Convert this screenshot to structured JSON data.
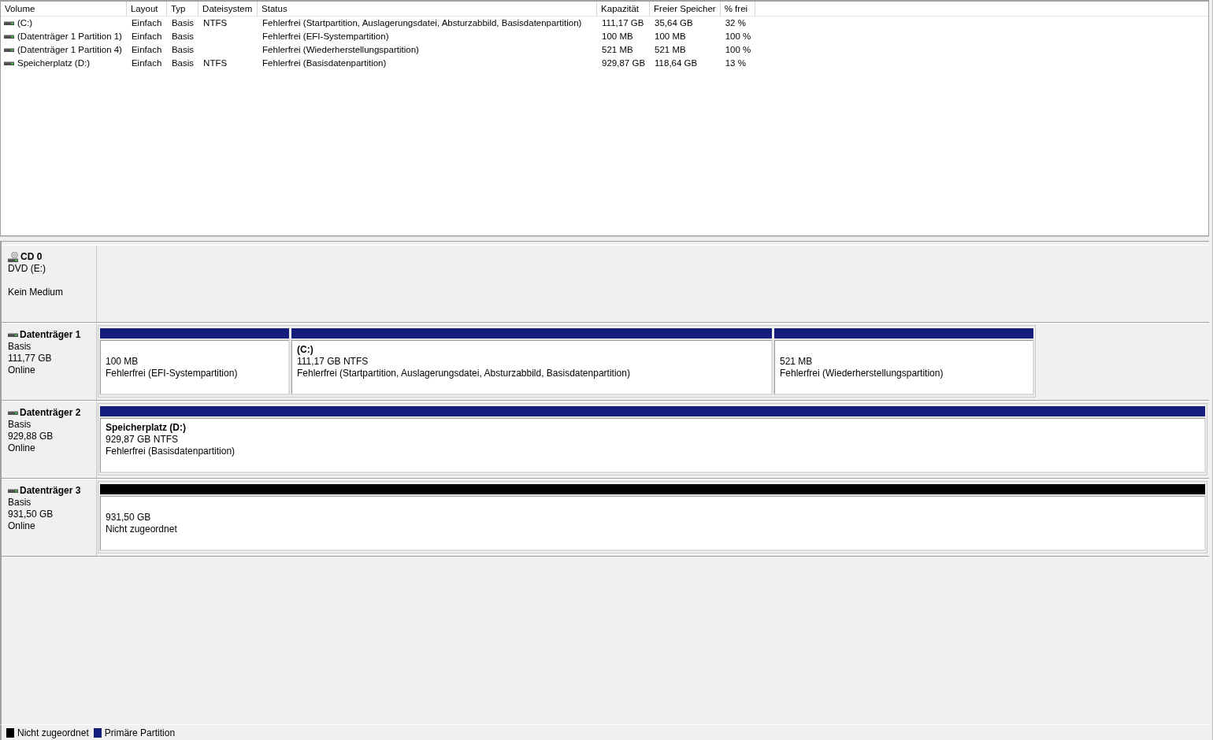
{
  "volume_list": {
    "columns": [
      "Volume",
      "Layout",
      "Typ",
      "Dateisystem",
      "Status",
      "Kapazität",
      "Freier Speicher",
      "% frei"
    ],
    "rows": [
      {
        "volume": "(C:)",
        "layout": "Einfach",
        "type": "Basis",
        "file_system": "NTFS",
        "status": "Fehlerfrei (Startpartition, Auslagerungsdatei, Absturzabbild, Basisdatenpartition)",
        "capacity": "111,17 GB",
        "free_space": "35,64 GB",
        "percent_free": "32 %"
      },
      {
        "volume": "(Datenträger 1 Partition 1)",
        "layout": "Einfach",
        "type": "Basis",
        "status": "Fehlerfrei (EFI-Systempartition)",
        "capacity": "100 MB",
        "free_space": "100 MB",
        "percent_free": "100 %"
      },
      {
        "volume": "(Datenträger 1 Partition 4)",
        "layout": "Einfach",
        "type": "Basis",
        "status": "Fehlerfrei (Wiederherstellungspartition)",
        "capacity": "521 MB",
        "free_space": "521 MB",
        "percent_free": "100 %"
      },
      {
        "volume": "Speicherplatz (D:)",
        "layout": "Einfach",
        "type": "Basis",
        "file_system": "NTFS",
        "status": "Fehlerfrei (Basisdatenpartition)",
        "capacity": "929,87 GB",
        "free_space": "118,64 GB",
        "percent_free": "13 %"
      }
    ]
  },
  "disks": [
    {
      "kind": "cd",
      "name": "CD 0",
      "type": "DVD (E:)",
      "status": "Kein Medium"
    },
    {
      "kind": "disk",
      "name": "Datenträger 1",
      "type": "Basis",
      "size": "111,77 GB",
      "status": "Online",
      "partitions": [
        {
          "kind": "primary",
          "size": "100 MB",
          "status": "Fehlerfrei (EFI-Systempartition)"
        },
        {
          "kind": "primary",
          "label": "(C:)",
          "size": "111,17 GB NTFS",
          "status": "Fehlerfrei (Startpartition, Auslagerungsdatei, Absturzabbild, Basisdatenpartition)"
        },
        {
          "kind": "primary",
          "size": "521 MB",
          "status": "Fehlerfrei (Wiederherstellungspartition)"
        }
      ]
    },
    {
      "kind": "disk",
      "name": "Datenträger 2",
      "type": "Basis",
      "size": "929,88 GB",
      "status": "Online",
      "partitions": [
        {
          "kind": "primary",
          "label": "Speicherplatz  (D:)",
          "size": "929,87 GB NTFS",
          "status": "Fehlerfrei (Basisdatenpartition)"
        }
      ]
    },
    {
      "kind": "disk",
      "name": "Datenträger 3",
      "type": "Basis",
      "size": "931,50 GB",
      "status": "Online",
      "partitions": [
        {
          "kind": "unallocated",
          "size": "931,50 GB",
          "status": "Nicht zugeordnet"
        }
      ]
    }
  ],
  "legend": [
    {
      "kind": "unallocated",
      "label": "Nicht zugeordnet",
      "color": "#000000"
    },
    {
      "kind": "primary",
      "label": "Primäre Partition",
      "color": "#141c7c"
    }
  ]
}
